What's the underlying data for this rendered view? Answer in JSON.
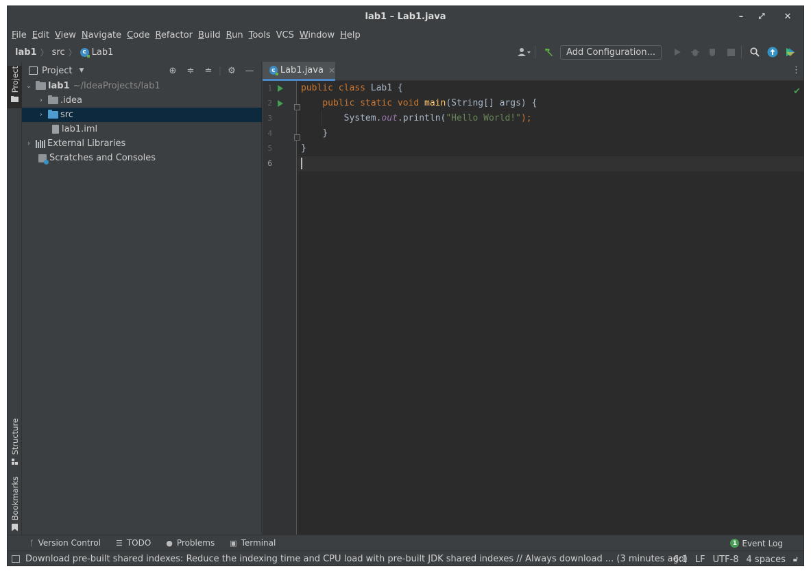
{
  "window": {
    "title": "lab1 – Lab1.java",
    "controls": [
      "–",
      "⤢",
      "✕"
    ]
  },
  "menu": [
    {
      "label": "File",
      "acc": "F",
      "rest": "ile"
    },
    {
      "label": "Edit",
      "acc": "E",
      "rest": "dit"
    },
    {
      "label": "View",
      "acc": "V",
      "rest": "iew"
    },
    {
      "label": "Navigate",
      "acc": "N",
      "rest": "avigate"
    },
    {
      "label": "Code",
      "acc": "C",
      "rest": "ode"
    },
    {
      "label": "Refactor",
      "acc": "R",
      "rest": "efactor"
    },
    {
      "label": "Build",
      "acc": "B",
      "rest": "uild"
    },
    {
      "label": "Run",
      "acc": "R",
      "rest": "un",
      "pre": "",
      "underline_idx": 1
    },
    {
      "label": "Tools",
      "acc": "T",
      "rest": "ools"
    },
    {
      "label": "VCS",
      "acc": "",
      "rest": "VCS"
    },
    {
      "label": "Window",
      "acc": "W",
      "rest": "indow"
    },
    {
      "label": "Help",
      "acc": "H",
      "rest": "elp"
    }
  ],
  "breadcrumb": {
    "project": "lab1",
    "folder": "src",
    "file": "Lab1"
  },
  "toolbar": {
    "add_configuration": "Add Configuration..."
  },
  "left_strip": {
    "project": "Project",
    "structure": "Structure",
    "bookmarks": "Bookmarks"
  },
  "project_panel": {
    "title": "Project",
    "tree": {
      "root": {
        "name": "lab1",
        "path": "~/IdeaProjects/lab1"
      },
      "idea": ".idea",
      "src": "src",
      "iml": "lab1.iml",
      "libraries": "External Libraries",
      "scratches": "Scratches and Consoles"
    }
  },
  "editor": {
    "tab": "Lab1.java",
    "line_numbers": [
      "1",
      "2",
      "3",
      "4",
      "5",
      "6"
    ],
    "code": {
      "l1": {
        "kw": "public class ",
        "name": "Lab1",
        "brace": " {"
      },
      "l2": {
        "indent": "    ",
        "kw": "public static void ",
        "fn": "main",
        "rest": "(String[] args) {"
      },
      "l3": {
        "indent": "        ",
        "pre": "System.",
        "field": "out",
        "mid": ".println(",
        "str": "\"Hello World!\"",
        "end": ");"
      },
      "l4": {
        "indent": "    ",
        "text": "}"
      },
      "l5": {
        "text": "}"
      }
    }
  },
  "bottom_tools": {
    "version_control": "Version Control",
    "todo": "TODO",
    "problems": "Problems",
    "terminal": "Terminal",
    "event_log": "Event Log",
    "event_count": "1"
  },
  "status": {
    "message": "Download pre-built shared indexes: Reduce the indexing time and CPU load with pre-built JDK shared indexes // Always download ... (3 minutes ago)",
    "position": "6:1",
    "line_sep": "LF",
    "encoding": "UTF-8",
    "indent": "4 spaces"
  },
  "colors": {
    "accent": "#4a88c7",
    "run_green": "#499c54",
    "selection": "#0d293e",
    "editor_bg": "#2b2b2b"
  }
}
